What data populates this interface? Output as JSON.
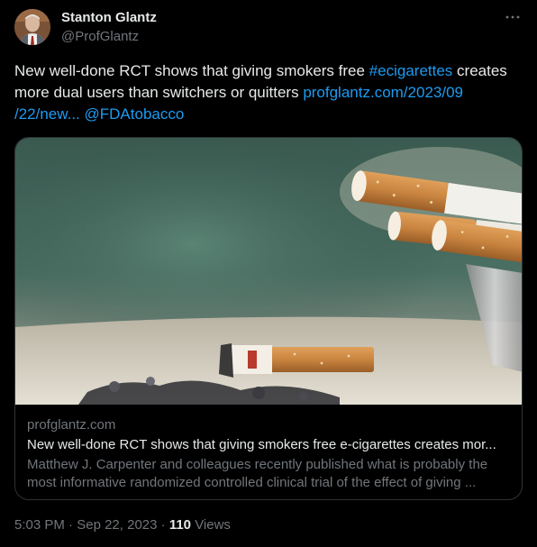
{
  "author": {
    "name": "Stanton Glantz",
    "handle": "@ProfGlantz"
  },
  "more_icon": "more-horizontal-icon",
  "tweet": {
    "text_part1": "New well-done RCT shows that giving smokers free ",
    "hashtag": "#ecigarettes",
    "text_part2": " creates more dual users than switchers or quitters  ",
    "url_line1": "profglantz.com/2023/09",
    "url_line2": "/22/new...",
    "mention": "@FDAtobacco"
  },
  "card": {
    "domain": "profglantz.com",
    "title": "New well-done RCT shows that giving smokers free e-cigarettes creates mor...",
    "description": "Matthew J. Carpenter and colleagues recently published what is probably the most informative randomized controlled clinical trial of the effect of giving ..."
  },
  "meta": {
    "time": "5:03 PM",
    "separator": " · ",
    "date": "Sep 22, 2023",
    "views_count": "110",
    "views_label": "Views"
  },
  "colors": {
    "background": "#000000",
    "link": "#1d9bf0",
    "secondary_text": "#71767b",
    "primary_text": "#e7e9ea"
  }
}
